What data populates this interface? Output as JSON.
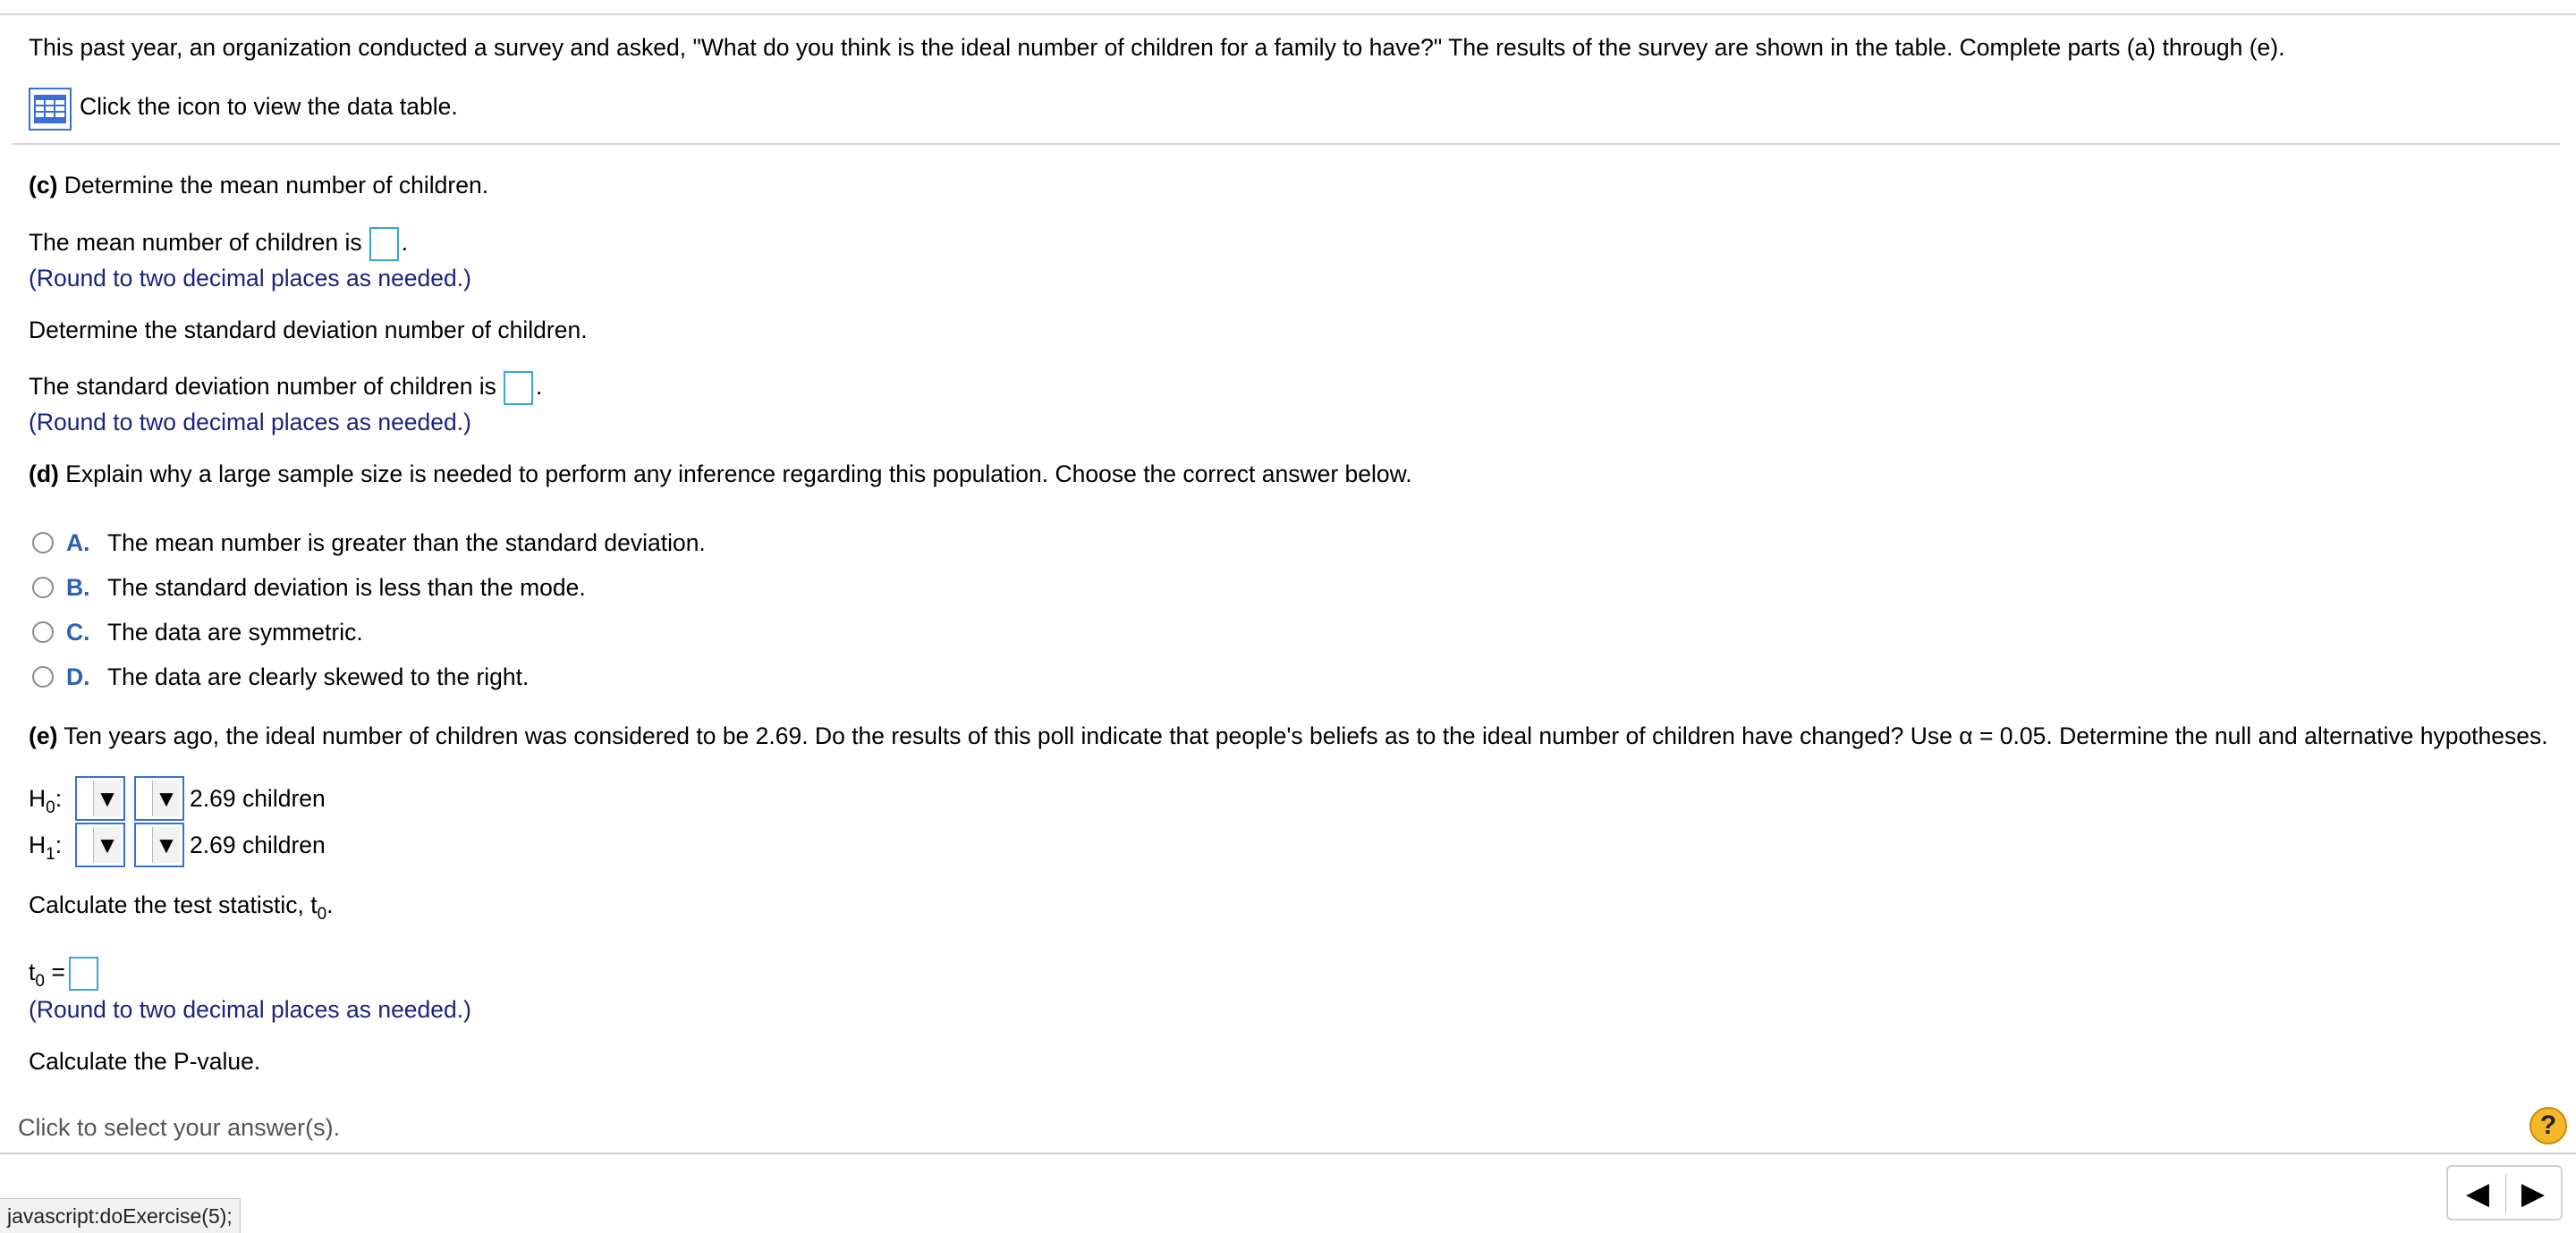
{
  "question": {
    "intro": "This past year, an organization conducted a survey and asked, \"What do you think is the ideal number of children for a family to have?\" The results of the survey are shown in the table. Complete parts (a) through (e).",
    "data_table_link": "Click the icon to view the data table."
  },
  "part_c": {
    "label": "(c)",
    "prompt": "Determine the mean number of children.",
    "mean_text": "The mean number of children is",
    "mean_suffix": ".",
    "mean_round": "(Round to two decimal places as needed.)",
    "sd_prompt": "Determine the standard deviation number of children.",
    "sd_text": "The standard deviation number of children is",
    "sd_suffix": ".",
    "sd_round": "(Round to two decimal places as needed.)"
  },
  "part_d": {
    "label": "(d)",
    "prompt": "Explain why a large sample size is needed to perform any inference regarding this population. Choose the correct answer below.",
    "options": [
      {
        "letter": "A.",
        "text": "The mean number is greater than the standard deviation."
      },
      {
        "letter": "B.",
        "text": "The standard deviation is less than the mode."
      },
      {
        "letter": "C.",
        "text": "The data are symmetric."
      },
      {
        "letter": "D.",
        "text": "The data are clearly skewed to the right."
      }
    ]
  },
  "part_e": {
    "label": "(e)",
    "prompt": "Ten years ago, the ideal number of children was considered to be 2.69. Do the results of this poll indicate that people's beliefs as to the ideal number of children have changed? Use α = 0.05. Determine the null and alternative hypotheses.",
    "h0_label": "H",
    "h0_sub": "0",
    "h1_label": "H",
    "h1_sub": "1",
    "colon": ":",
    "value_text": "2.69 children",
    "arrow": "▼",
    "test_stat_prompt": "Calculate the test statistic, t",
    "test_stat_sub": "0",
    "test_stat_end": ".",
    "t0_label": "t",
    "t0_sub": "0",
    "t0_eq": "=",
    "t0_round": "(Round to two decimal places as needed.)",
    "pvalue_prompt": "Calculate the P-value."
  },
  "footer": {
    "instruction": "Click to select your answer(s).",
    "help": "?",
    "prev": "◀",
    "next": "▶"
  },
  "status_bar": {
    "text": "javascript:doExercise(5);"
  },
  "colors": {
    "accent_blue": "#2f5fb3",
    "round_note": "#1a237e",
    "answer_box_border": "#3ba4d8",
    "help_icon": "#f5b928"
  }
}
